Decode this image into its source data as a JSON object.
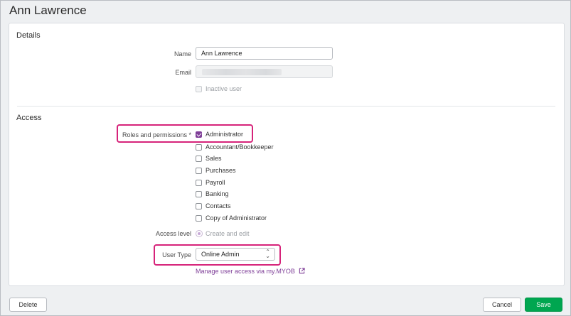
{
  "page": {
    "title": "Ann Lawrence"
  },
  "details": {
    "section_title": "Details",
    "name_label": "Name",
    "name_value": "Ann Lawrence",
    "email_label": "Email",
    "inactive_label": "Inactive user"
  },
  "access": {
    "section_title": "Access",
    "roles_label": "Roles and permissions *",
    "roles": [
      {
        "label": "Administrator",
        "checked": true
      },
      {
        "label": "Accountant/Bookkeeper",
        "checked": false
      },
      {
        "label": "Sales",
        "checked": false
      },
      {
        "label": "Purchases",
        "checked": false
      },
      {
        "label": "Payroll",
        "checked": false
      },
      {
        "label": "Banking",
        "checked": false
      },
      {
        "label": "Contacts",
        "checked": false
      },
      {
        "label": "Copy of Administrator",
        "checked": false
      }
    ],
    "access_level_label": "Access level",
    "access_level_value": "Create and edit",
    "user_type_label": "User Type",
    "user_type_value": "Online Admin",
    "manage_link": "Manage user access via my.MYOB"
  },
  "footer": {
    "delete_label": "Delete",
    "cancel_label": "Cancel",
    "save_label": "Save"
  },
  "colors": {
    "accent": "#7f3f98",
    "highlight": "#d6237a",
    "save_button": "#00a650"
  }
}
